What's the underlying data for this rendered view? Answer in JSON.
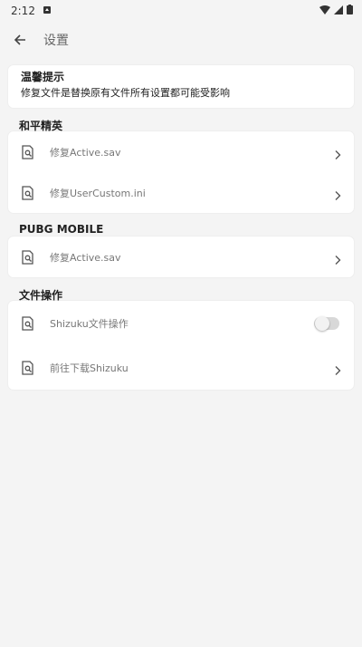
{
  "status_bar": {
    "time": "2:12"
  },
  "app_bar": {
    "title": "设置"
  },
  "tip": {
    "title": "温馨提示",
    "text": "修复文件是替换原有文件所有设置都可能受影响"
  },
  "sections": [
    {
      "header": "和平精英",
      "items": [
        {
          "label": "修复Active.sav"
        },
        {
          "label": "修复UserCustom.ini"
        }
      ]
    },
    {
      "header": "PUBG MOBILE",
      "items": [
        {
          "label": "修复Active.sav"
        }
      ]
    },
    {
      "header": "文件操作",
      "items": [
        {
          "label": "Shizuku文件操作",
          "toggle": false
        },
        {
          "label": "前往下载Shizuku"
        }
      ]
    }
  ],
  "colors": {
    "background": "#f4f4f4",
    "card": "#ffffff",
    "label": "#777777"
  }
}
